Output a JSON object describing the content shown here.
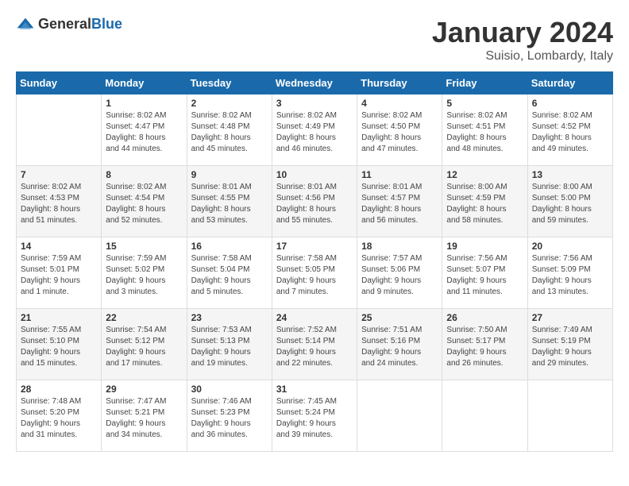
{
  "logo": {
    "general": "General",
    "blue": "Blue"
  },
  "header": {
    "month": "January 2024",
    "location": "Suisio, Lombardy, Italy"
  },
  "weekdays": [
    "Sunday",
    "Monday",
    "Tuesday",
    "Wednesday",
    "Thursday",
    "Friday",
    "Saturday"
  ],
  "weeks": [
    [
      {
        "day": null,
        "info": null
      },
      {
        "day": "1",
        "info": "Sunrise: 8:02 AM\nSunset: 4:47 PM\nDaylight: 8 hours\nand 44 minutes."
      },
      {
        "day": "2",
        "info": "Sunrise: 8:02 AM\nSunset: 4:48 PM\nDaylight: 8 hours\nand 45 minutes."
      },
      {
        "day": "3",
        "info": "Sunrise: 8:02 AM\nSunset: 4:49 PM\nDaylight: 8 hours\nand 46 minutes."
      },
      {
        "day": "4",
        "info": "Sunrise: 8:02 AM\nSunset: 4:50 PM\nDaylight: 8 hours\nand 47 minutes."
      },
      {
        "day": "5",
        "info": "Sunrise: 8:02 AM\nSunset: 4:51 PM\nDaylight: 8 hours\nand 48 minutes."
      },
      {
        "day": "6",
        "info": "Sunrise: 8:02 AM\nSunset: 4:52 PM\nDaylight: 8 hours\nand 49 minutes."
      }
    ],
    [
      {
        "day": "7",
        "info": "Sunrise: 8:02 AM\nSunset: 4:53 PM\nDaylight: 8 hours\nand 51 minutes."
      },
      {
        "day": "8",
        "info": "Sunrise: 8:02 AM\nSunset: 4:54 PM\nDaylight: 8 hours\nand 52 minutes."
      },
      {
        "day": "9",
        "info": "Sunrise: 8:01 AM\nSunset: 4:55 PM\nDaylight: 8 hours\nand 53 minutes."
      },
      {
        "day": "10",
        "info": "Sunrise: 8:01 AM\nSunset: 4:56 PM\nDaylight: 8 hours\nand 55 minutes."
      },
      {
        "day": "11",
        "info": "Sunrise: 8:01 AM\nSunset: 4:57 PM\nDaylight: 8 hours\nand 56 minutes."
      },
      {
        "day": "12",
        "info": "Sunrise: 8:00 AM\nSunset: 4:59 PM\nDaylight: 8 hours\nand 58 minutes."
      },
      {
        "day": "13",
        "info": "Sunrise: 8:00 AM\nSunset: 5:00 PM\nDaylight: 8 hours\nand 59 minutes."
      }
    ],
    [
      {
        "day": "14",
        "info": "Sunrise: 7:59 AM\nSunset: 5:01 PM\nDaylight: 9 hours\nand 1 minute."
      },
      {
        "day": "15",
        "info": "Sunrise: 7:59 AM\nSunset: 5:02 PM\nDaylight: 9 hours\nand 3 minutes."
      },
      {
        "day": "16",
        "info": "Sunrise: 7:58 AM\nSunset: 5:04 PM\nDaylight: 9 hours\nand 5 minutes."
      },
      {
        "day": "17",
        "info": "Sunrise: 7:58 AM\nSunset: 5:05 PM\nDaylight: 9 hours\nand 7 minutes."
      },
      {
        "day": "18",
        "info": "Sunrise: 7:57 AM\nSunset: 5:06 PM\nDaylight: 9 hours\nand 9 minutes."
      },
      {
        "day": "19",
        "info": "Sunrise: 7:56 AM\nSunset: 5:07 PM\nDaylight: 9 hours\nand 11 minutes."
      },
      {
        "day": "20",
        "info": "Sunrise: 7:56 AM\nSunset: 5:09 PM\nDaylight: 9 hours\nand 13 minutes."
      }
    ],
    [
      {
        "day": "21",
        "info": "Sunrise: 7:55 AM\nSunset: 5:10 PM\nDaylight: 9 hours\nand 15 minutes."
      },
      {
        "day": "22",
        "info": "Sunrise: 7:54 AM\nSunset: 5:12 PM\nDaylight: 9 hours\nand 17 minutes."
      },
      {
        "day": "23",
        "info": "Sunrise: 7:53 AM\nSunset: 5:13 PM\nDaylight: 9 hours\nand 19 minutes."
      },
      {
        "day": "24",
        "info": "Sunrise: 7:52 AM\nSunset: 5:14 PM\nDaylight: 9 hours\nand 22 minutes."
      },
      {
        "day": "25",
        "info": "Sunrise: 7:51 AM\nSunset: 5:16 PM\nDaylight: 9 hours\nand 24 minutes."
      },
      {
        "day": "26",
        "info": "Sunrise: 7:50 AM\nSunset: 5:17 PM\nDaylight: 9 hours\nand 26 minutes."
      },
      {
        "day": "27",
        "info": "Sunrise: 7:49 AM\nSunset: 5:19 PM\nDaylight: 9 hours\nand 29 minutes."
      }
    ],
    [
      {
        "day": "28",
        "info": "Sunrise: 7:48 AM\nSunset: 5:20 PM\nDaylight: 9 hours\nand 31 minutes."
      },
      {
        "day": "29",
        "info": "Sunrise: 7:47 AM\nSunset: 5:21 PM\nDaylight: 9 hours\nand 34 minutes."
      },
      {
        "day": "30",
        "info": "Sunrise: 7:46 AM\nSunset: 5:23 PM\nDaylight: 9 hours\nand 36 minutes."
      },
      {
        "day": "31",
        "info": "Sunrise: 7:45 AM\nSunset: 5:24 PM\nDaylight: 9 hours\nand 39 minutes."
      },
      {
        "day": null,
        "info": null
      },
      {
        "day": null,
        "info": null
      },
      {
        "day": null,
        "info": null
      }
    ]
  ]
}
